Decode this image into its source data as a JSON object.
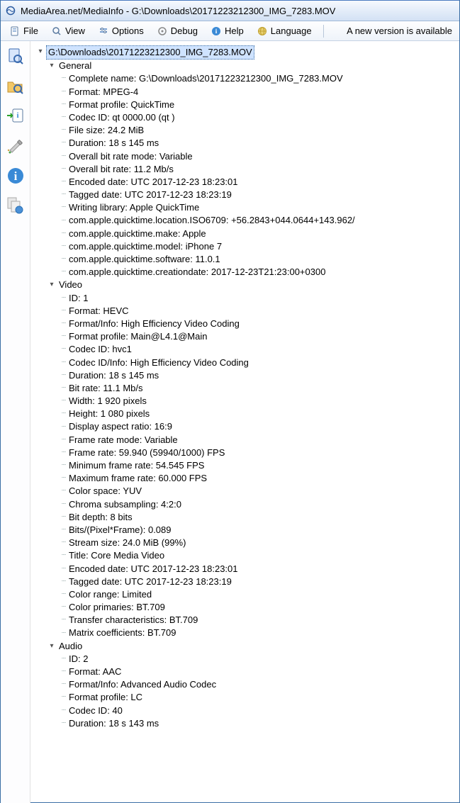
{
  "window": {
    "title": "MediaArea.net/MediaInfo - G:\\Downloads\\20171223212300_IMG_7283.MOV"
  },
  "menubar": {
    "file": "File",
    "view": "View",
    "options": "Options",
    "debug": "Debug",
    "help": "Help",
    "language": "Language",
    "update": "A new version is available"
  },
  "tree": {
    "root_label": "G:\\Downloads\\20171223212300_IMG_7283.MOV",
    "sections": [
      {
        "name": "General",
        "items": [
          "Complete name: G:\\Downloads\\20171223212300_IMG_7283.MOV",
          "Format: MPEG-4",
          "Format profile: QuickTime",
          "Codec ID: qt   0000.00 (qt  )",
          "File size: 24.2 MiB",
          "Duration: 18 s 145 ms",
          "Overall bit rate mode: Variable",
          "Overall bit rate: 11.2 Mb/s",
          "Encoded date: UTC 2017-12-23 18:23:01",
          "Tagged date: UTC 2017-12-23 18:23:19",
          "Writing library: Apple QuickTime",
          "com.apple.quicktime.location.ISO6709: +56.2843+044.0644+143.962/",
          "com.apple.quicktime.make: Apple",
          "com.apple.quicktime.model: iPhone 7",
          "com.apple.quicktime.software: 11.0.1",
          "com.apple.quicktime.creationdate: 2017-12-23T21:23:00+0300"
        ]
      },
      {
        "name": "Video",
        "items": [
          "ID: 1",
          "Format: HEVC",
          "Format/Info: High Efficiency Video Coding",
          "Format profile: Main@L4.1@Main",
          "Codec ID: hvc1",
          "Codec ID/Info: High Efficiency Video Coding",
          "Duration: 18 s 145 ms",
          "Bit rate: 11.1 Mb/s",
          "Width: 1 920 pixels",
          "Height: 1 080 pixels",
          "Display aspect ratio: 16:9",
          "Frame rate mode: Variable",
          "Frame rate: 59.940 (59940/1000) FPS",
          "Minimum frame rate: 54.545 FPS",
          "Maximum frame rate: 60.000 FPS",
          "Color space: YUV",
          "Chroma subsampling: 4:2:0",
          "Bit depth: 8 bits",
          "Bits/(Pixel*Frame): 0.089",
          "Stream size: 24.0 MiB (99%)",
          "Title: Core Media Video",
          "Encoded date: UTC 2017-12-23 18:23:01",
          "Tagged date: UTC 2017-12-23 18:23:19",
          "Color range: Limited",
          "Color primaries: BT.709",
          "Transfer characteristics: BT.709",
          "Matrix coefficients: BT.709"
        ]
      },
      {
        "name": "Audio",
        "items": [
          "ID: 2",
          "Format: AAC",
          "Format/Info: Advanced Audio Codec",
          "Format profile: LC",
          "Codec ID: 40",
          "Duration: 18 s 143 ms"
        ]
      }
    ]
  }
}
